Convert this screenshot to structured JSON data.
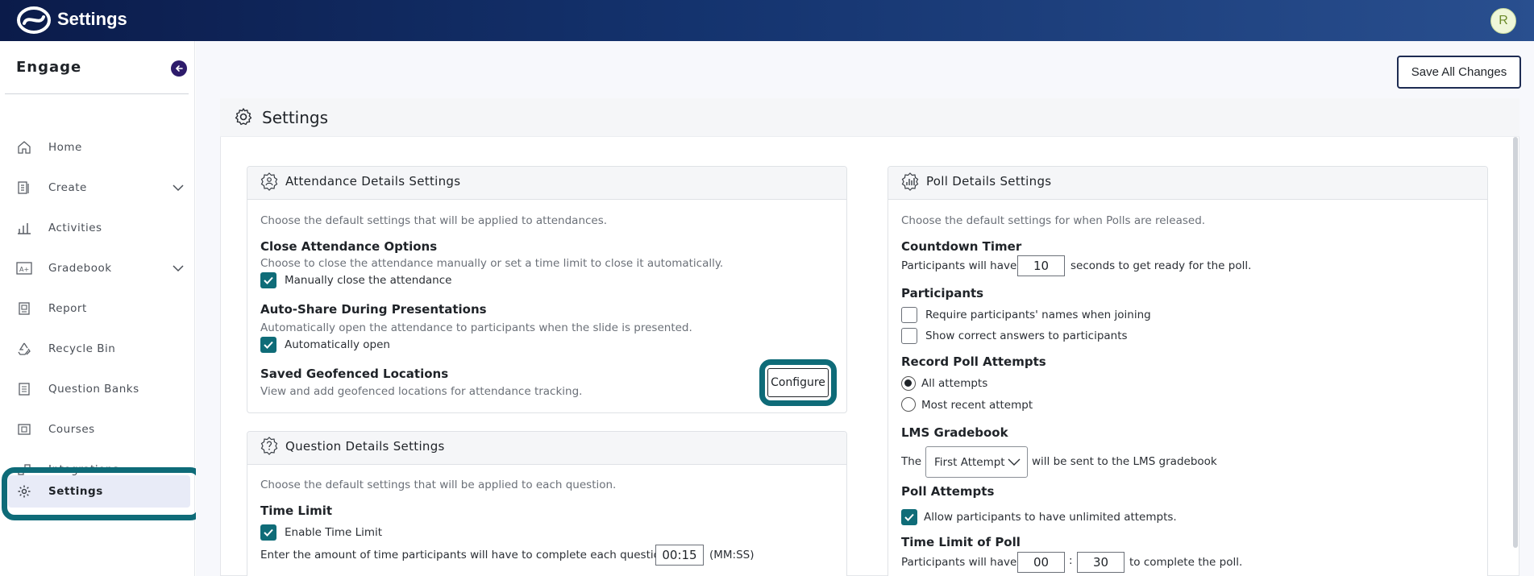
{
  "topbar": {
    "app_title": "Settings",
    "user_initial": "R"
  },
  "sidebar": {
    "brand": "Engage",
    "items": [
      {
        "label": "Home",
        "icon": "home-icon"
      },
      {
        "label": "Create",
        "icon": "create-icon",
        "expandable": true
      },
      {
        "label": "Activities",
        "icon": "bar-chart-icon"
      },
      {
        "label": "Gradebook",
        "icon": "gradebook-icon",
        "expandable": true
      },
      {
        "label": "Report",
        "icon": "report-icon"
      },
      {
        "label": "Recycle Bin",
        "icon": "recycle-icon"
      },
      {
        "label": "Question Banks",
        "icon": "question-bank-icon"
      },
      {
        "label": "Courses",
        "icon": "courses-icon"
      },
      {
        "label": "Integrations",
        "icon": "integrations-icon"
      },
      {
        "label": "Settings",
        "icon": "gear-icon",
        "active": true
      }
    ]
  },
  "main": {
    "save_all_label": "Save All Changes",
    "panel_title": "Settings",
    "attendance": {
      "title": "Attendance Details Settings",
      "intro": "Choose the default settings that will be applied to attendances.",
      "close_heading": "Close Attendance Options",
      "close_desc": "Choose to close the attendance manually or set a time limit to close it automatically.",
      "close_checkbox": "Manually close the attendance",
      "autoshare_heading": "Auto-Share During Presentations",
      "autoshare_desc": "Automatically open the attendance to participants when the slide is presented.",
      "autoshare_checkbox": "Automatically open",
      "geo_heading": "Saved Geofenced Locations",
      "geo_desc": "View and add geofenced locations for attendance tracking.",
      "configure_label": "Configure"
    },
    "question": {
      "title": "Question Details Settings",
      "intro": "Choose the default settings that will be applied to each question.",
      "time_heading": "Time Limit",
      "time_checkbox": "Enable Time Limit",
      "time_desc": "Enter the amount of time participants will have to complete each question",
      "time_value": "00:15",
      "time_unit": "(MM:SS)"
    },
    "poll": {
      "title": "Poll Details Settings",
      "intro": "Choose the default settings for when Polls are released.",
      "countdown_heading": "Countdown Timer",
      "countdown_prefix": "Participants will have",
      "countdown_value": "10",
      "countdown_suffix": "seconds to get ready for the poll.",
      "participants_heading": "Participants",
      "require_names": "Require participants' names when joining",
      "show_answers": "Show correct answers to participants",
      "record_heading": "Record Poll Attempts",
      "all_attempts": "All attempts",
      "recent_attempt": "Most recent attempt",
      "lms_heading": "LMS Gradebook",
      "lms_prefix": "The",
      "lms_select": "First Attempt",
      "lms_suffix": "will be sent to the LMS gradebook",
      "attempts_heading": "Poll Attempts",
      "unlimited_attempts": "Allow participants to have unlimited attempts.",
      "limit_heading": "Time Limit of Poll",
      "limit_prefix": "Participants will have",
      "limit_minutes": "00",
      "limit_sep": ":",
      "limit_seconds": "30",
      "limit_suffix": "to complete the poll."
    }
  }
}
